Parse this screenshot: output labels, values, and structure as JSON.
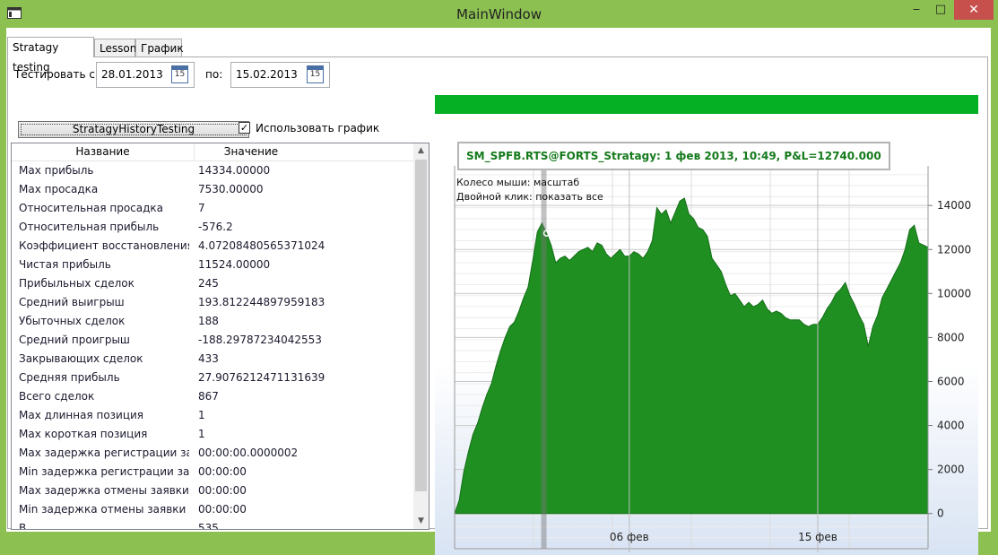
{
  "window": {
    "title": "MainWindow",
    "icon": "app-window-icon",
    "minimize": "‒",
    "maximize": "□",
    "close": "✕"
  },
  "tabs": [
    {
      "label": "Stratagy testing",
      "active": true
    },
    {
      "label": "Lesson",
      "active": false
    },
    {
      "label": "График",
      "active": false
    }
  ],
  "form": {
    "from_label": "Тестировать с:",
    "from_date": "28.01.2013",
    "to_label": "по:",
    "to_date": "15.02.2013",
    "calendar_day": "15",
    "run_button": "StratagyHistoryTesting",
    "use_chart_label": "Использовать график",
    "use_chart_checked": true
  },
  "progress": {
    "fraction": 1.0,
    "color": "#06b025"
  },
  "stats": {
    "headers": {
      "name": "Название",
      "value": "Значение"
    },
    "rows": [
      {
        "name": "Max прибыль",
        "value": "14334.00000"
      },
      {
        "name": "Max просадка",
        "value": "7530.00000"
      },
      {
        "name": "Относительная просадка",
        "value": "7"
      },
      {
        "name": "Относительная прибыль",
        "value": "-576.2"
      },
      {
        "name": "Коэффициент восстановления",
        "value": "4.07208480565371024"
      },
      {
        "name": "Чистая прибыль",
        "value": "11524.00000"
      },
      {
        "name": "Прибыльных сделок",
        "value": "245"
      },
      {
        "name": "Средний выигрыш",
        "value": "193.812244897959183"
      },
      {
        "name": "Убыточных сделок",
        "value": "188"
      },
      {
        "name": "Средний проигрыш",
        "value": "-188.29787234042553"
      },
      {
        "name": "Закрывающих сделок",
        "value": "433"
      },
      {
        "name": "Средняя прибыль",
        "value": "27.9076212471131639"
      },
      {
        "name": "Всего сделок",
        "value": "867"
      },
      {
        "name": "Max длинная позиция",
        "value": "1"
      },
      {
        "name": "Max короткая позиция",
        "value": "1"
      },
      {
        "name": "Max задержка регистрации заявки",
        "value": "00:00:00.0000002"
      },
      {
        "name": "Min задержка регистрации заявки",
        "value": "00:00:00"
      },
      {
        "name": "Max задержка отмены заявки",
        "value": "00:00:00"
      },
      {
        "name": "Min задержка отмены заявки",
        "value": "00:00:00"
      },
      {
        "name": "В",
        "value": "535"
      }
    ]
  },
  "chart_panel": {
    "legend": "SM_SPFB.RTS@FORTS_Stratagy:    1 фев 2013, 10:49, P&L=12740.000",
    "hint_zoom": "Колесо мыши: масштаб",
    "hint_reset": "Двойной клик: показать все"
  },
  "chart_data": {
    "type": "area",
    "series": [
      {
        "name": "SM_SPFB.RTS@FORTS_Stratagy",
        "color": "#1f8f22",
        "values": [
          0,
          600,
          1900,
          2800,
          3600,
          4100,
          4800,
          5400,
          5900,
          6700,
          7400,
          8000,
          8500,
          8700,
          9200,
          9800,
          10300,
          11500,
          12800,
          13200,
          12740,
          12200,
          11400,
          11600,
          11700,
          11500,
          11700,
          11900,
          12000,
          12100,
          11900,
          12300,
          12200,
          11800,
          11600,
          11800,
          12000,
          11700,
          11700,
          11900,
          11800,
          11600,
          11900,
          12400,
          13900,
          13600,
          13800,
          13200,
          13700,
          14200,
          14334,
          13600,
          13400,
          13000,
          12900,
          12600,
          11600,
          11300,
          11000,
          10400,
          9900,
          10000,
          9700,
          9400,
          9600,
          9400,
          9500,
          9700,
          9300,
          9100,
          9200,
          9100,
          8900,
          8800,
          8800,
          8800,
          8600,
          8500,
          8600,
          8600,
          8900,
          9300,
          9600,
          10000,
          10200,
          10500,
          9900,
          9500,
          9000,
          8600,
          7600,
          8500,
          9000,
          9800,
          10200,
          10600,
          11000,
          11400,
          12000,
          12900,
          13100,
          12300,
          12200,
          12100
        ]
      }
    ],
    "x_ticks": [
      "06 фев",
      "15 фев"
    ],
    "x_tick_positions": [
      38,
      79
    ],
    "y_ticks": [
      0,
      2000,
      4000,
      6000,
      8000,
      10000,
      12000,
      14000
    ],
    "ylim": [
      -1600,
      15800
    ],
    "marker_index": 20,
    "grid": true
  }
}
